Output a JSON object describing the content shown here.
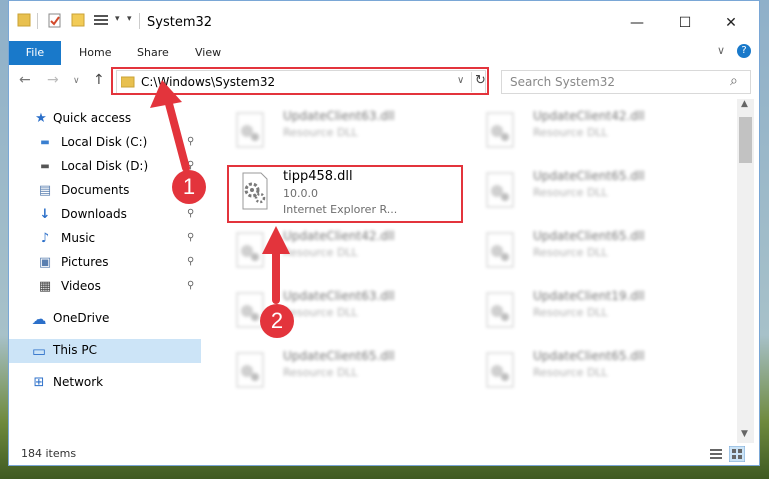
{
  "window": {
    "title": "System32",
    "minimize_glyph": "—",
    "maximize_glyph": "☐",
    "close_glyph": "✕"
  },
  "ribbon": {
    "tabs": [
      "File",
      "Home",
      "Share",
      "View"
    ],
    "chevron_glyph": "∨",
    "help_glyph": "?"
  },
  "nav": {
    "back_glyph": "←",
    "forward_glyph": "→",
    "history_glyph": "∨",
    "up_glyph": "↑",
    "address": "C:\\Windows\\System32",
    "address_dropdown_glyph": "∨",
    "refresh_glyph": "↻",
    "search_placeholder": "Search System32",
    "search_glyph": "⌕"
  },
  "sidebar": {
    "items": [
      {
        "label": "Quick access",
        "icon": "star-icon",
        "glyph": "★",
        "color": "#2b6fc9",
        "pinned": false
      },
      {
        "label": "Local Disk (C:)",
        "icon": "drive-icon",
        "glyph": "▬",
        "color": "#3a7fd0",
        "pinned": true
      },
      {
        "label": "Local Disk (D:)",
        "icon": "drive-icon",
        "glyph": "▬",
        "color": "#555555",
        "pinned": true
      },
      {
        "label": "Documents",
        "icon": "documents-icon",
        "glyph": "▤",
        "color": "#5a7fb0",
        "pinned": true
      },
      {
        "label": "Downloads",
        "icon": "download-icon",
        "glyph": "↓",
        "color": "#2b6fc9",
        "pinned": true
      },
      {
        "label": "Music",
        "icon": "music-icon",
        "glyph": "♪",
        "color": "#2b6fc9",
        "pinned": true
      },
      {
        "label": "Pictures",
        "icon": "pictures-icon",
        "glyph": "▣",
        "color": "#5a7fb0",
        "pinned": true
      },
      {
        "label": "Videos",
        "icon": "videos-icon",
        "glyph": "▦",
        "color": "#444444",
        "pinned": true
      },
      {
        "label": "OneDrive",
        "icon": "cloud-icon",
        "glyph": "☁",
        "color": "#2b6fc9",
        "pinned": false
      },
      {
        "label": "This PC",
        "icon": "computer-icon",
        "glyph": "▭",
        "color": "#2b6fc9",
        "pinned": false
      },
      {
        "label": "Network",
        "icon": "network-icon",
        "glyph": "⊞",
        "color": "#2b6fc9",
        "pinned": false
      }
    ],
    "pin_glyph": "⚲"
  },
  "files": [
    {
      "name": "UpdateClient63.dll",
      "type": "Resource DLL",
      "version": ""
    },
    {
      "name": "UpdateClient42.dll",
      "type": "Resource DLL",
      "version": ""
    },
    {
      "name": "tipp458.dll",
      "type": "Internet Explorer R...",
      "version": "10.0.0"
    },
    {
      "name": "UpdateClient65.dll",
      "type": "Resource DLL",
      "version": ""
    },
    {
      "name": "UpdateClient42.dll",
      "type": "Resource DLL",
      "version": ""
    },
    {
      "name": "UpdateClient65.dll",
      "type": "Resource DLL",
      "version": ""
    },
    {
      "name": "UpdateClient63.dll",
      "type": "Resource DLL",
      "version": ""
    },
    {
      "name": "UpdateClient19.dll",
      "type": "Resource DLL",
      "version": ""
    },
    {
      "name": "UpdateClient65.dll",
      "type": "Resource DLL",
      "version": ""
    },
    {
      "name": "UpdateClient65.dll",
      "type": "Resource DLL",
      "version": ""
    }
  ],
  "status": {
    "item_count": "184 items"
  },
  "annotations": {
    "step1": "1",
    "step2": "2",
    "color": "#e3343c"
  }
}
